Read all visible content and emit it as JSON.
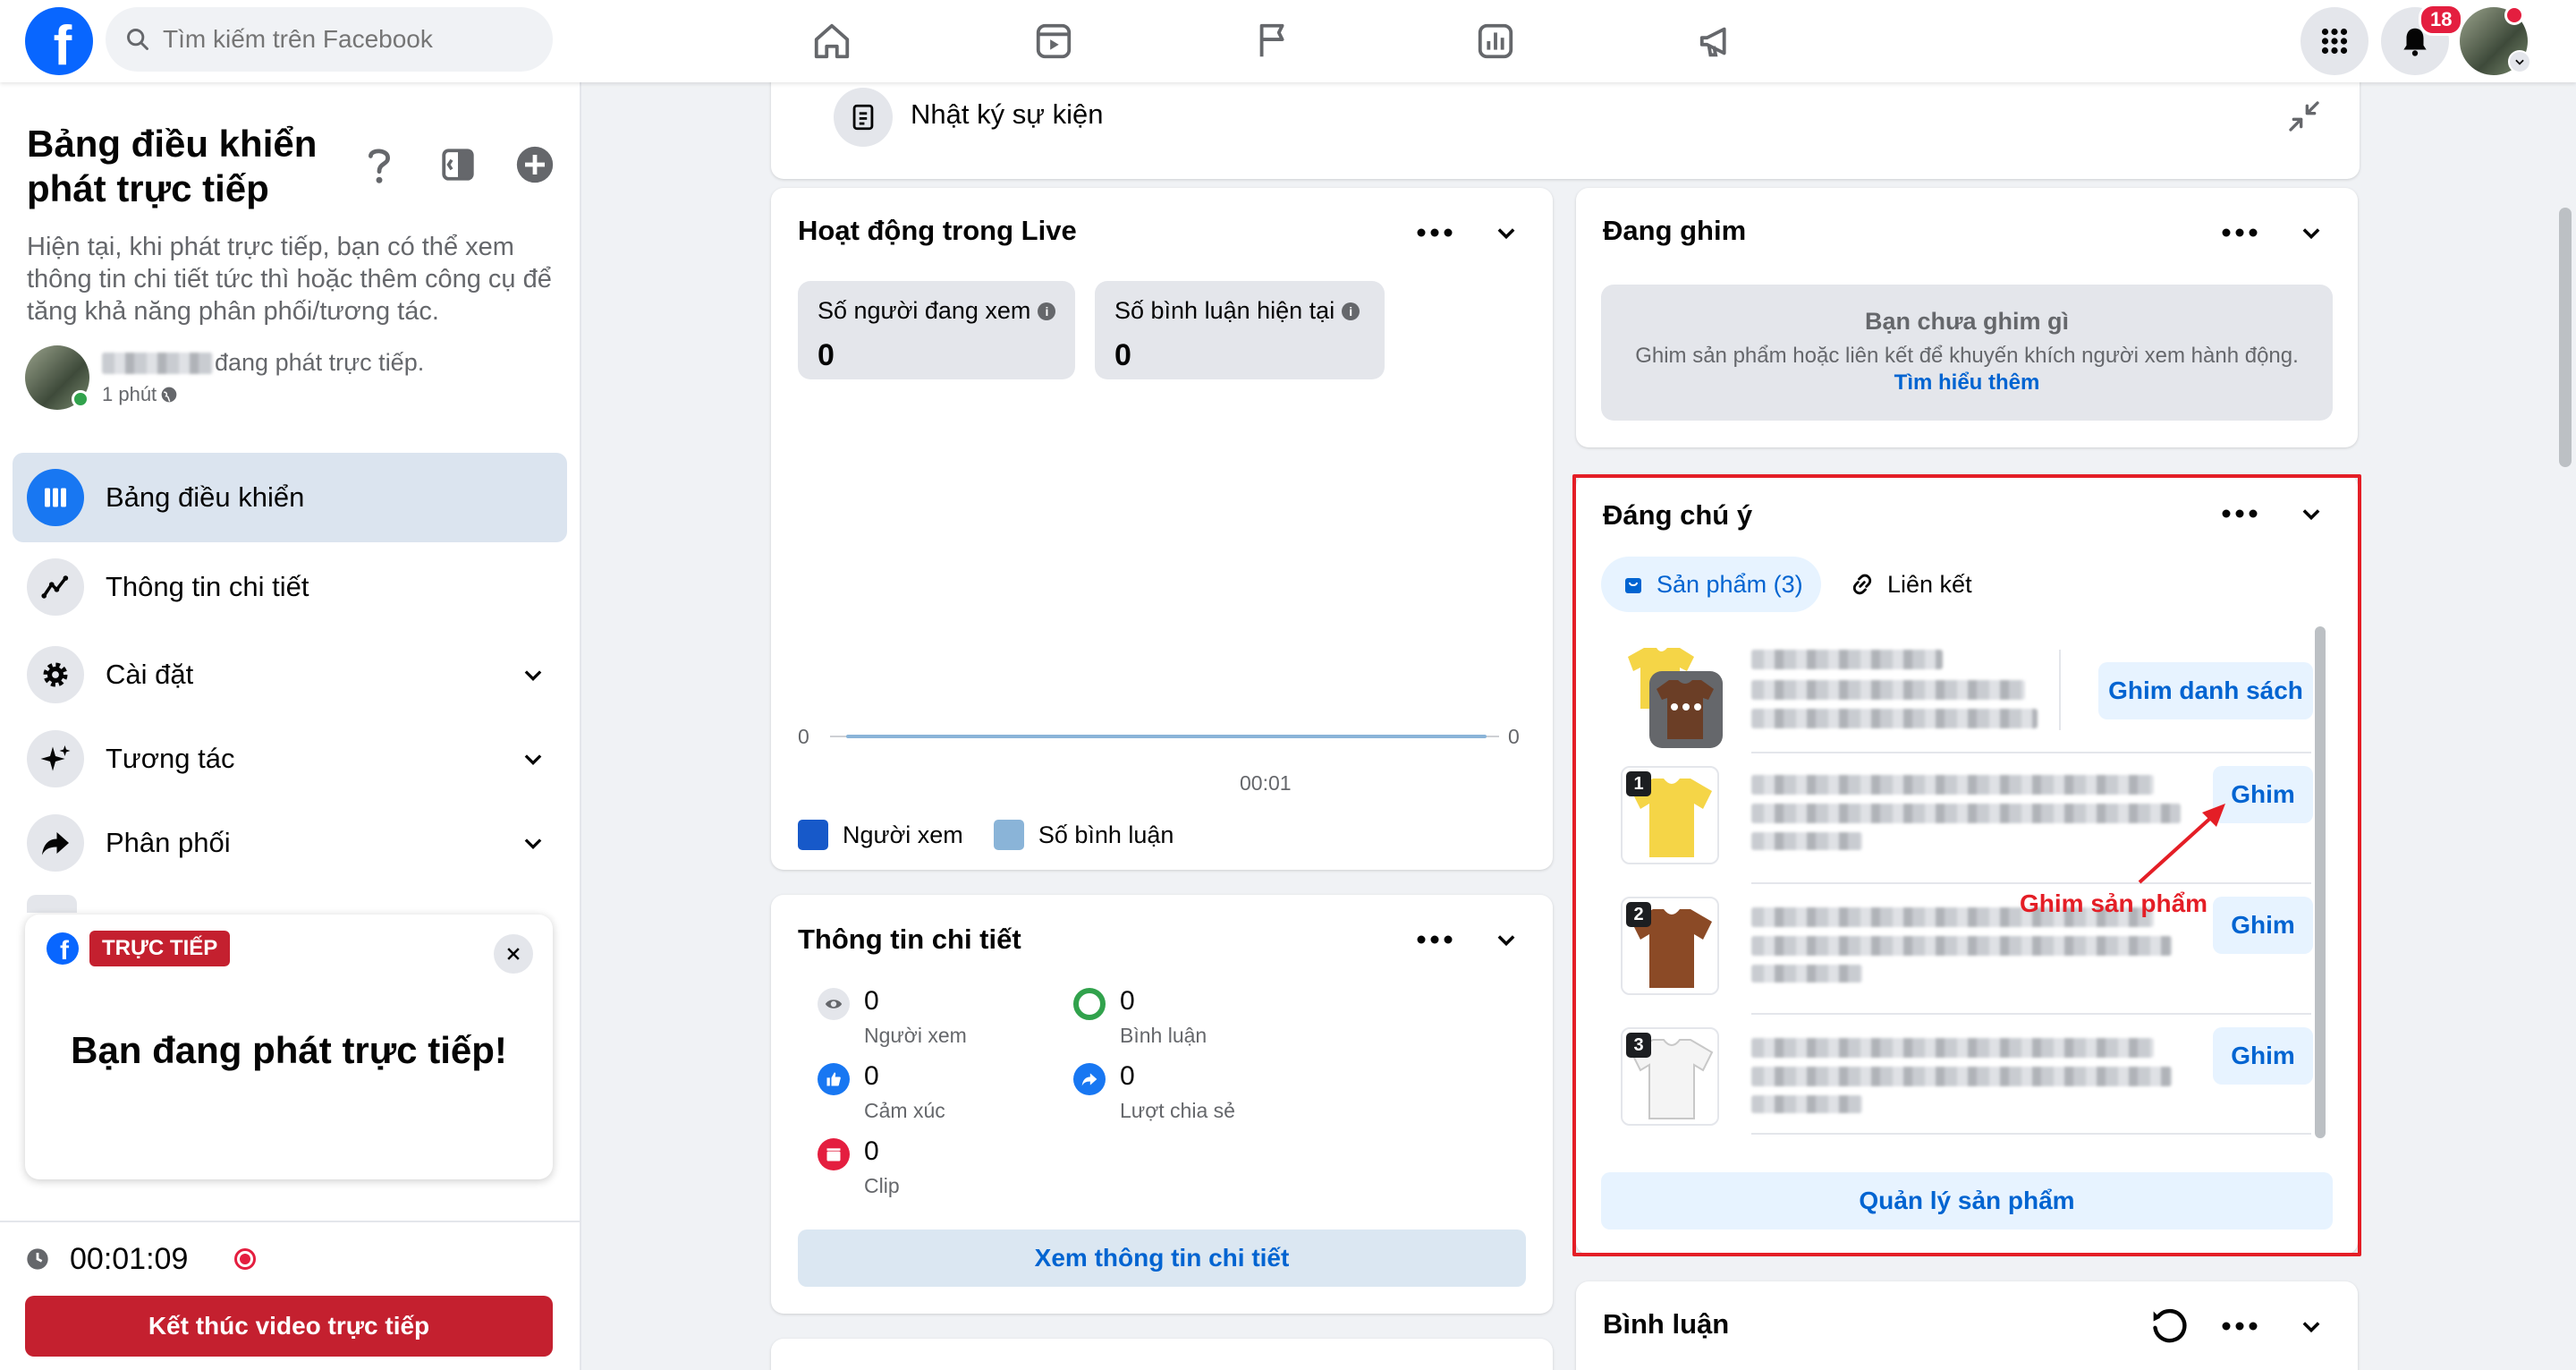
{
  "topbar": {
    "search_placeholder": "Tìm kiếm trên Facebook",
    "notification_count": "18"
  },
  "sidebar": {
    "title": "Bảng điều khiển phát trực tiếp",
    "description": "Hiện tại, khi phát trực tiếp, bạn có thể xem thông tin chi tiết tức thì hoặc thêm công cụ để tăng khả năng phân phối/tương tác.",
    "user_status": "đang phát trực tiếp.",
    "user_time": "1 phút",
    "items": [
      {
        "label": "Bảng điều khiển",
        "icon": "dashboard-icon",
        "active": true,
        "has_chevron": false
      },
      {
        "label": "Thông tin chi tiết",
        "icon": "insights-icon",
        "active": false,
        "has_chevron": false
      },
      {
        "label": "Cài đặt",
        "icon": "gear-icon",
        "active": false,
        "has_chevron": true
      },
      {
        "label": "Tương tác",
        "icon": "sparkle-icon",
        "active": false,
        "has_chevron": true
      },
      {
        "label": "Phân phối",
        "icon": "share-icon",
        "active": false,
        "has_chevron": true
      }
    ],
    "live_card": {
      "tag": "TRỰC TIẾP",
      "message": "Bạn đang phát trực tiếp!"
    },
    "timer": "00:01:09",
    "end_button": "Kết thúc video trực tiếp"
  },
  "events_log": {
    "label": "Nhật ký sự kiện"
  },
  "activity": {
    "title": "Hoạt động trong Live",
    "viewers_label": "Số người đang xem",
    "viewers_value": "0",
    "comments_label": "Số bình luận hiện tại",
    "comments_value": "0",
    "axis_left": "0",
    "axis_right": "0",
    "x_tick": "00:01",
    "legend_viewers": "Người xem",
    "legend_comments": "Số bình luận",
    "color_viewers": "#1759c9",
    "color_comments": "#8ab4d8"
  },
  "details": {
    "title": "Thông tin chi tiết",
    "metrics": [
      {
        "value": "0",
        "label": "Người xem"
      },
      {
        "value": "0",
        "label": "Bình luận"
      },
      {
        "value": "0",
        "label": "Cảm xúc"
      },
      {
        "value": "0",
        "label": "Lượt chia sẻ"
      },
      {
        "value": "0",
        "label": "Clip"
      }
    ],
    "button": "Xem thông tin chi tiết"
  },
  "pinned": {
    "title": "Đang ghim",
    "empty_title": "Bạn chưa ghim gì",
    "empty_desc": "Ghim sản phẩm hoặc liên kết để khuyến khích người xem hành động.",
    "learn_more": "Tìm hiểu thêm"
  },
  "featured": {
    "title": "Đáng chú ý",
    "tab_products": "Sản phẩm (3)",
    "tab_links": "Liên kết",
    "pin_list_button": "Ghim danh sách",
    "pin_button": "Ghim",
    "products": [
      {
        "number": "1",
        "color": "yellow"
      },
      {
        "number": "2",
        "color": "brown"
      },
      {
        "number": "3",
        "color": "white"
      }
    ],
    "annotation": "Ghim sản phẩm",
    "manage_button": "Quản lý sản phẩm",
    "highlight_color": "#e41e26"
  },
  "comments": {
    "title": "Bình luận"
  }
}
